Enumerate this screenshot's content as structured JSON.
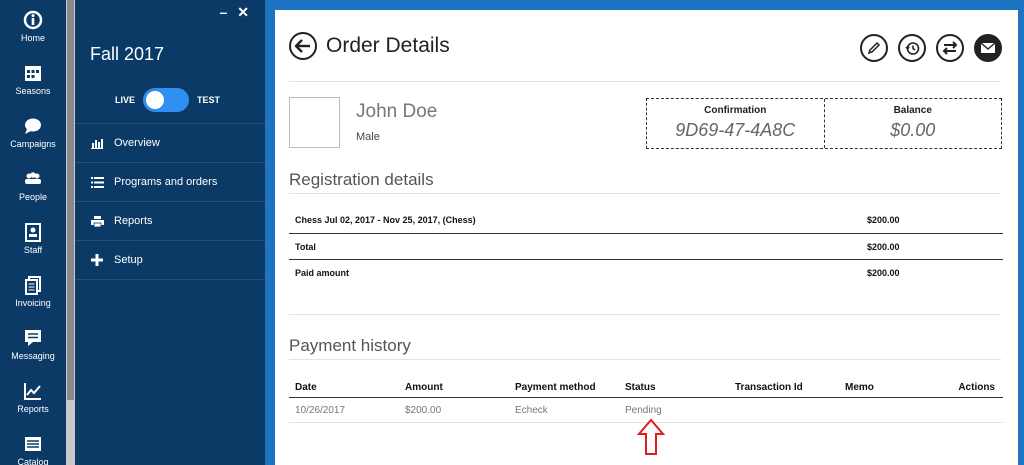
{
  "rail": {
    "items": [
      {
        "label": "Home",
        "icon": "info-circle-icon"
      },
      {
        "label": "Seasons",
        "icon": "calendar-icon"
      },
      {
        "label": "Campaigns",
        "icon": "chat-bubble-icon"
      },
      {
        "label": "People",
        "icon": "people-icon"
      },
      {
        "label": "Staff",
        "icon": "staff-badge-icon"
      },
      {
        "label": "Invoicing",
        "icon": "documents-icon"
      },
      {
        "label": "Messaging",
        "icon": "message-icon"
      },
      {
        "label": "Reports",
        "icon": "line-chart-icon"
      },
      {
        "label": "Catalog",
        "icon": "catalog-icon"
      }
    ]
  },
  "nav": {
    "season": "Fall 2017",
    "toggle_left": "LIVE",
    "toggle_right": "TEST",
    "items": [
      {
        "label": "Overview",
        "icon": "bar-chart-icon"
      },
      {
        "label": "Programs and orders",
        "icon": "list-icon"
      },
      {
        "label": "Reports",
        "icon": "printer-icon"
      },
      {
        "label": "Setup",
        "icon": "plus-icon"
      }
    ],
    "minimize": "–",
    "close": "✕"
  },
  "order": {
    "title": "Order Details",
    "person_name": "John Doe",
    "person_gender": "Male",
    "confirmation_label": "Confirmation",
    "confirmation_value": "9D69-47-4A8C",
    "balance_label": "Balance",
    "balance_value": "$0.00"
  },
  "registration": {
    "title": "Registration details",
    "rows": [
      {
        "desc": "Chess Jul 02, 2017 - Nov 25, 2017, (Chess)",
        "amount": "$200.00"
      },
      {
        "desc": "Total",
        "amount": "$200.00"
      },
      {
        "desc": "Paid amount",
        "amount": "$200.00"
      }
    ]
  },
  "payments": {
    "title": "Payment history",
    "headers": [
      "Date",
      "Amount",
      "Payment method",
      "Status",
      "Transaction Id",
      "Memo",
      "Actions"
    ],
    "rows": [
      [
        "10/26/2017",
        "$200.00",
        "Echeck",
        "Pending",
        "",
        "",
        ""
      ]
    ]
  },
  "colors": {
    "sidebar": "#0b3a66",
    "accent": "#2f8ff0",
    "annotation_arrow": "#e21b1b"
  }
}
